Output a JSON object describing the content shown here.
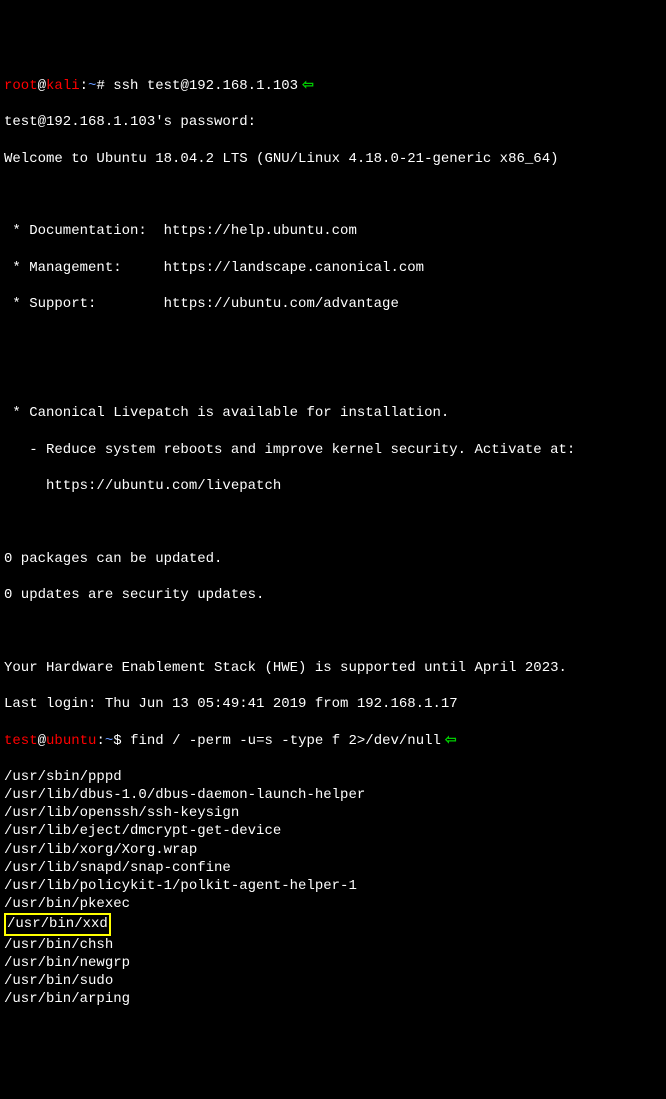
{
  "prompt1": {
    "user": "root",
    "at": "@",
    "host": "kali",
    "path_sep": ":",
    "path": "~",
    "hash": "#",
    "command": "ssh test@192.168.1.103"
  },
  "lines": {
    "pw": "test@192.168.1.103's password:",
    "welcome": "Welcome to Ubuntu 18.04.2 LTS (GNU/Linux 4.18.0-21-generic x86_64)",
    "blank": " ",
    "doc": " * Documentation:  https://help.ubuntu.com",
    "mgmt": " * Management:     https://landscape.canonical.com",
    "support": " * Support:        https://ubuntu.com/advantage",
    "livepatch1": " * Canonical Livepatch is available for installation.",
    "livepatch2": "   - Reduce system reboots and improve kernel security. Activate at:",
    "livepatch3": "     https://ubuntu.com/livepatch",
    "pkg1": "0 packages can be updated.",
    "pkg2": "0 updates are security updates.",
    "hwe": "Your Hardware Enablement Stack (HWE) is supported until April 2023.",
    "lastlogin": "Last login: Thu Jun 13 05:49:41 2019 from 192.168.1.17"
  },
  "prompt2": {
    "user": "test",
    "at": "@",
    "host": "ubuntu",
    "path_sep": ":",
    "path": "~",
    "dollar": "$",
    "command": "find / -perm -u=s -type f 2>/dev/null"
  },
  "results": [
    "/usr/sbin/pppd",
    "/usr/lib/dbus-1.0/dbus-daemon-launch-helper",
    "/usr/lib/openssh/ssh-keysign",
    "/usr/lib/eject/dmcrypt-get-device",
    "/usr/lib/xorg/Xorg.wrap",
    "/usr/lib/snapd/snap-confine",
    "/usr/lib/policykit-1/polkit-agent-helper-1",
    "/usr/bin/pkexec",
    "/usr/bin/xxd",
    "/usr/bin/chsh",
    "/usr/bin/newgrp",
    "/usr/bin/sudo",
    "/usr/bin/arping"
  ],
  "highlighted_result": "/usr/bin/xxd",
  "arrow_glyph": "⇦"
}
